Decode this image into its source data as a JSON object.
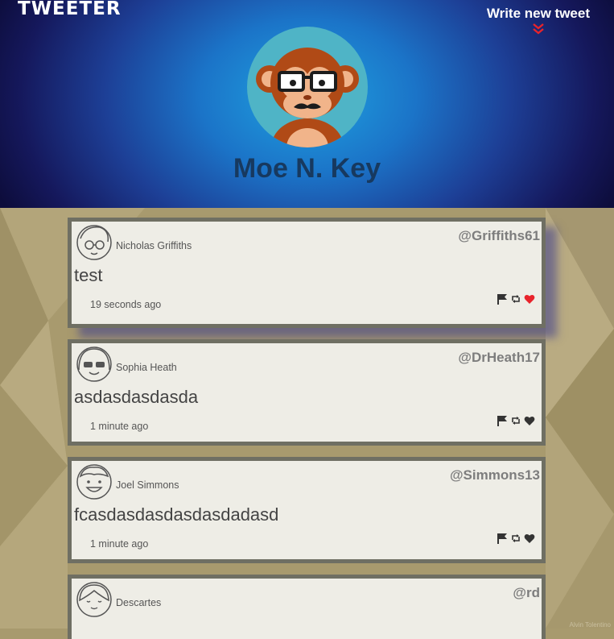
{
  "app": {
    "logo": "TWEETER"
  },
  "header": {
    "write_label": "Write new tweet",
    "profile_name": "Moe N. Key"
  },
  "colors": {
    "accent": "#e8232b",
    "name_color": "#17395f",
    "card_border": "#6f6f63"
  },
  "tweets": [
    {
      "name": "Nicholas Griffiths",
      "handle": "@Griffiths61",
      "text": "test",
      "time": "19 seconds ago",
      "liked": true,
      "avatar": "glasses-person-icon"
    },
    {
      "name": "Sophia Heath",
      "handle": "@DrHeath17",
      "text": "asdasdasdasda",
      "time": "1 minute ago",
      "liked": false,
      "avatar": "sunglasses-person-icon"
    },
    {
      "name": "Joel Simmons",
      "handle": "@Simmons13",
      "text": "fcasdasdasdasdasdadasd",
      "time": "1 minute ago",
      "liked": false,
      "avatar": "smiling-person-icon"
    },
    {
      "name": "Descartes",
      "handle": "@rd",
      "text": "",
      "time": "",
      "liked": false,
      "avatar": "girl-person-icon"
    }
  ],
  "footer": {
    "credit": "Alvin Tolentino"
  }
}
